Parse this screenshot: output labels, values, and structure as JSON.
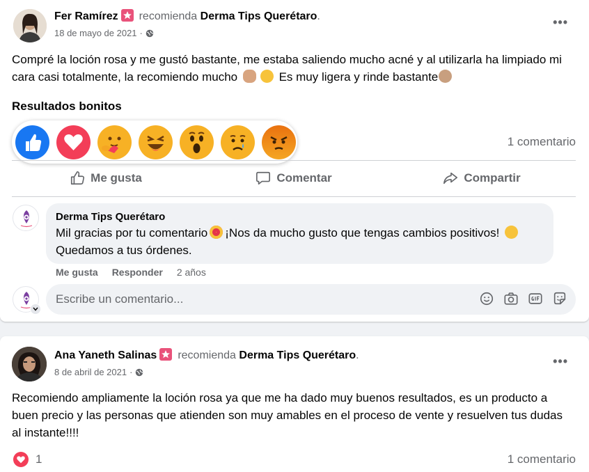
{
  "post1": {
    "author": "Fer Ramírez",
    "recommends": "recomienda",
    "page": "Derma Tips Querétaro",
    "date": "18 de mayo de 2021",
    "text_part1": "Compré la loción rosa y me gustó bastante, me estaba saliendo mucho acné y al utilizarla ha limpiado mi cara casi totalmente, la recomiendo mucho",
    "text_part2": "Es muy ligera y rinde bastante",
    "results_label": "Resultados bonitos",
    "comment_count": "1 comentario",
    "actions": {
      "like": "Me gusta",
      "comment": "Comentar",
      "share": "Compartir"
    },
    "reply": {
      "author": "Derma Tips Querétaro",
      "text_part1": "Mil gracias por tu comentario",
      "text_part2": "¡Nos da mucho gusto que tengas cambios positivos!",
      "text_part3": "Quedamos a tus órdenes.",
      "like": "Me gusta",
      "respond": "Responder",
      "time": "2 años"
    },
    "write_placeholder": "Escribe un comentario..."
  },
  "post2": {
    "author": "Ana Yaneth Salinas",
    "recommends": "recomienda",
    "page": "Derma Tips Querétaro",
    "date": "8 de abril de 2021",
    "text": "Recomiendo ampliamente la loción rosa ya que me ha dado muy buenos resultados, es un producto a buen precio y las personas que atienden son muy amables en el proceso de vente y resuelven tus dudas al instante!!!!",
    "reaction_count": "1",
    "comment_count": "1 comentario"
  },
  "colors": {
    "accent_pink": "#e9527a",
    "like_blue": "#1877f2",
    "love_red": "#f33e58",
    "muted": "#65676b"
  }
}
